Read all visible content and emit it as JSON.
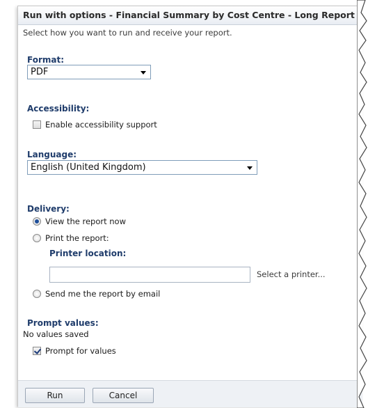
{
  "dialog": {
    "title": "Run with options - Financial Summary by Cost Centre - Long Report",
    "subtitle": "Select how you want to run and receive your report."
  },
  "format": {
    "label": "Format:",
    "value": "PDF"
  },
  "accessibility": {
    "label": "Accessibility:",
    "checkbox_label": "Enable accessibility support",
    "checked": false
  },
  "language": {
    "label": "Language:",
    "value": "English (United Kingdom)"
  },
  "delivery": {
    "label": "Delivery:",
    "view_now": "View the report now",
    "print": "Print the report:",
    "printer_location_label": "Printer location:",
    "printer_location_value": "",
    "select_printer": "Select a printer...",
    "email": "Send me the report by email",
    "selected": "view_now"
  },
  "prompt": {
    "label": "Prompt values:",
    "status": "No values saved",
    "checkbox_label": "Prompt for values",
    "checked": true
  },
  "footer": {
    "run_label": "Run",
    "cancel_label": "Cancel"
  },
  "colors": {
    "section_label": "#1f3c6b",
    "footer_bg": "#eef1f5",
    "border": "#7f9db9"
  }
}
